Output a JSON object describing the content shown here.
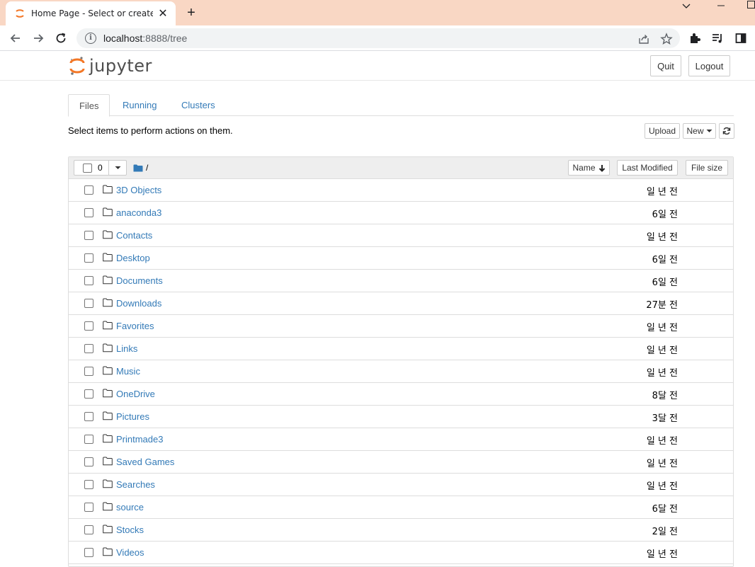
{
  "browser": {
    "tab_title": "Home Page - Select or create a",
    "url_host": "localhost",
    "url_rest": ":8888/tree"
  },
  "jupyter": {
    "logo_text": "jupyter",
    "quit_label": "Quit",
    "logout_label": "Logout"
  },
  "tabs": [
    "Files",
    "Running",
    "Clusters"
  ],
  "toolbar": {
    "hint": "Select items to perform actions on them.",
    "upload_label": "Upload",
    "new_label": "New"
  },
  "list_header": {
    "selected_count": "0",
    "path": "/",
    "name_label": "Name",
    "modified_label": "Last Modified",
    "size_label": "File size"
  },
  "files": [
    {
      "name": "3D Objects",
      "modified": "일 년 전"
    },
    {
      "name": "anaconda3",
      "modified": "6일 전"
    },
    {
      "name": "Contacts",
      "modified": "일 년 전"
    },
    {
      "name": "Desktop",
      "modified": "6일 전"
    },
    {
      "name": "Documents",
      "modified": "6일 전"
    },
    {
      "name": "Downloads",
      "modified": "27분 전"
    },
    {
      "name": "Favorites",
      "modified": "일 년 전"
    },
    {
      "name": "Links",
      "modified": "일 년 전"
    },
    {
      "name": "Music",
      "modified": "일 년 전"
    },
    {
      "name": "OneDrive",
      "modified": "8달 전"
    },
    {
      "name": "Pictures",
      "modified": "3달 전"
    },
    {
      "name": "Printmade3",
      "modified": "일 년 전"
    },
    {
      "name": "Saved Games",
      "modified": "일 년 전"
    },
    {
      "name": "Searches",
      "modified": "일 년 전"
    },
    {
      "name": "source",
      "modified": "6달 전"
    },
    {
      "name": "Stocks",
      "modified": "2일 전"
    },
    {
      "name": "Videos",
      "modified": "일 년 전"
    }
  ],
  "colors": {
    "titlebar": "#f9d7c4",
    "link": "#337ab7",
    "jupyter_orange": "#f37726"
  }
}
